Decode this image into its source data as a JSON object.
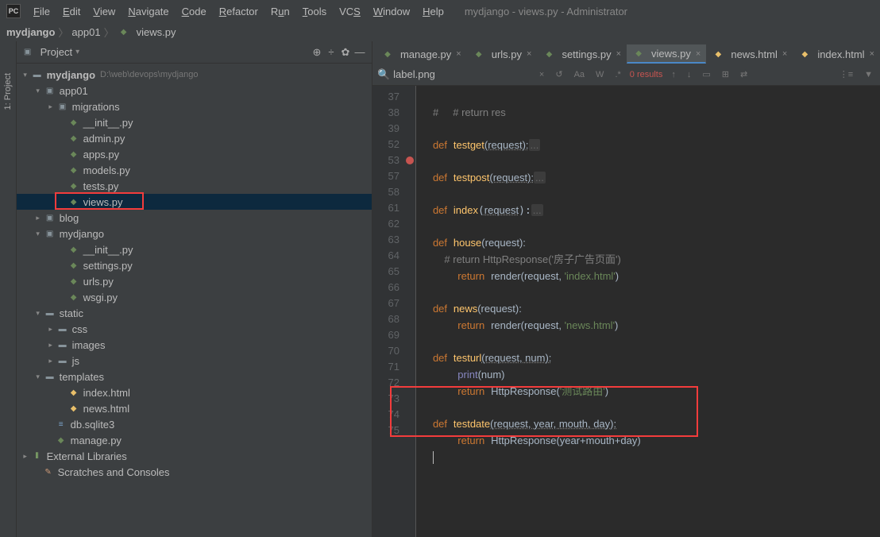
{
  "window": {
    "title": "mydjango - views.py - Administrator"
  },
  "menu": [
    "File",
    "Edit",
    "View",
    "Navigate",
    "Code",
    "Refactor",
    "Run",
    "Tools",
    "VCS",
    "Window",
    "Help"
  ],
  "breadcrumb": {
    "root": "mydjango",
    "mid": "app01",
    "file": "views.py"
  },
  "left_rail": "1: Project",
  "sidebar": {
    "title": "Project",
    "tree": {
      "root": {
        "name": "mydjango",
        "path": "D:\\web\\devops\\mydjango"
      },
      "app01": {
        "name": "app01",
        "migrations": "migrations",
        "files": [
          "__init__.py",
          "admin.py",
          "apps.py",
          "models.py",
          "tests.py",
          "views.py"
        ]
      },
      "blog": "blog",
      "mydjango_pkg": {
        "name": "mydjango",
        "files": [
          "__init__.py",
          "settings.py",
          "urls.py",
          "wsgi.py"
        ]
      },
      "static": {
        "name": "static",
        "dirs": [
          "css",
          "images",
          "js"
        ]
      },
      "templates": {
        "name": "templates",
        "files": [
          "index.html",
          "news.html"
        ]
      },
      "loose": [
        "db.sqlite3",
        "manage.py"
      ],
      "ext_lib": "External Libraries",
      "scratches": "Scratches and Consoles"
    }
  },
  "tabs": [
    {
      "name": "manage.py",
      "icon": "py"
    },
    {
      "name": "urls.py",
      "icon": "py"
    },
    {
      "name": "settings.py",
      "icon": "py"
    },
    {
      "name": "views.py",
      "icon": "py",
      "active": true
    },
    {
      "name": "news.html",
      "icon": "html"
    },
    {
      "name": "index.html",
      "icon": "html"
    }
  ],
  "find": {
    "query": "label.png",
    "results": "0 results"
  },
  "code": {
    "lines": [
      37,
      38,
      39,
      52,
      53,
      57,
      58,
      61,
      62,
      63,
      64,
      65,
      66,
      67,
      68,
      69,
      70,
      71,
      72,
      73,
      74,
      75
    ],
    "breakpoint_line": 53,
    "l37": "#     # return res",
    "l39_def": "def",
    "l39_fn": "testget",
    "l39_sig": "(request):",
    "l39_fold": "...",
    "l53_def": "def",
    "l53_fn": "testpost",
    "l53_sig": "(request):",
    "l53_fold": "...",
    "l58_def": "def",
    "l58_fn": "index",
    "l58_par": "request",
    "l58_fold": "...",
    "l62_def": "def",
    "l62_fn": "house",
    "l62_sig": "(request):",
    "l63": "    # return HttpResponse('房子广告页面')",
    "l64_ret": "return",
    "l64_call": "render(request, ",
    "l64_str": "'index.html'",
    "l64_end": ")",
    "l66_def": "def",
    "l66_fn": "news",
    "l66_sig": "(request):",
    "l67_ret": "return",
    "l67_call": "render(request, ",
    "l67_str": "'news.html'",
    "l67_end": ")",
    "l69_def": "def",
    "l69_fn": "testurl",
    "l69_sig": "(request, num):",
    "l70_print": "print",
    "l70_arg": "(num)",
    "l71_ret": "return",
    "l71_call": "HttpResponse(",
    "l71_str": "'测试路由'",
    "l71_end": ")",
    "l73_def": "def",
    "l73_fn": "testdate",
    "l73_sig": "(request, year, mouth, day):",
    "l74_ret": "return",
    "l74_call": "HttpResponse(year+mouth+day)"
  }
}
